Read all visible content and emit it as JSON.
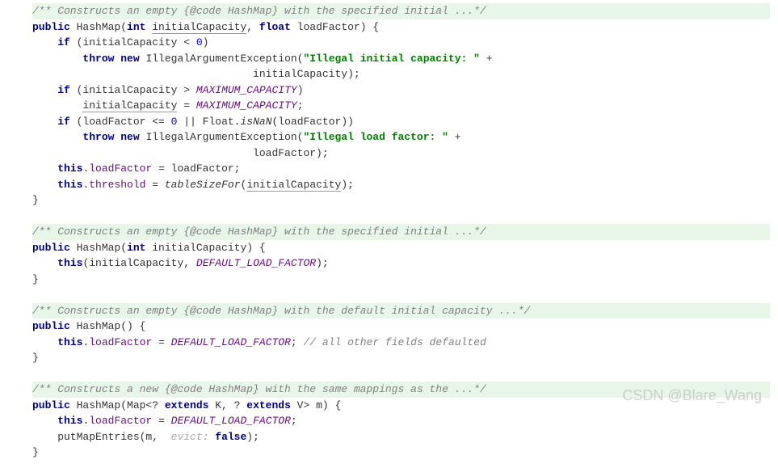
{
  "block1": {
    "doc": "/** Constructs an empty {@code HashMap} with the specified initial ...*/",
    "sig_kw1": "public",
    "sig_name": " HashMap(",
    "sig_kw2": "int",
    "sig_p1": "initialCapacity",
    "sig_sep": ", ",
    "sig_kw3": "float",
    "sig_p2": " loadFactor) {",
    "l1_kw": "if",
    "l1_rest": " (initialCapacity < ",
    "l1_num": "0",
    "l1_end": ")",
    "l2_kw1": "throw new",
    "l2_cls": " IllegalArgumentException(",
    "l2_str": "\"Illegal initial capacity: \"",
    "l2_end": " +",
    "l3": "                                   initialCapacity);",
    "l4_kw": "if",
    "l4_rest": " (initialCapacity > ",
    "l4_const": "MAXIMUM_CAPACITY",
    "l4_end": ")",
    "l5_p": "initialCapacity",
    "l5_mid": " = ",
    "l5_const": "MAXIMUM_CAPACITY",
    "l5_end": ";",
    "l6_kw": "if",
    "l6_a": " (loadFactor <= ",
    "l6_num": "0",
    "l6_b": " || Float.",
    "l6_m": "isNaN",
    "l6_c": "(loadFactor))",
    "l7_kw": "throw new",
    "l7_cls": " IllegalArgumentException(",
    "l7_str": "\"Illegal load factor: \"",
    "l7_end": " +",
    "l8": "                                   loadFactor);",
    "l9_kw": "this",
    "l9_a": ".",
    "l9_f": "loadFactor",
    "l9_b": " = loadFactor;",
    "l10_kw": "this",
    "l10_a": ".",
    "l10_f": "threshold",
    "l10_b": " = ",
    "l10_m": "tableSizeFor",
    "l10_c": "(",
    "l10_p": "initialCapacity",
    "l10_d": ");",
    "close": "}"
  },
  "block2": {
    "doc": "/** Constructs an empty {@code HashMap} with the specified initial ...*/",
    "sig_kw1": "public",
    "sig_name": " HashMap(",
    "sig_kw2": "int",
    "sig_p1": " initialCapacity) {",
    "l1_kw": "this",
    "l1_a": "(initialCapacity, ",
    "l1_const": "DEFAULT_LOAD_FACTOR",
    "l1_b": ");",
    "close": "}"
  },
  "block3": {
    "doc": "/** Constructs an empty {@code HashMap} with the default initial capacity ...*/",
    "sig_kw1": "public",
    "sig_name": " HashMap() {",
    "l1_kw": "this",
    "l1_a": ".",
    "l1_f": "loadFactor",
    "l1_b": " = ",
    "l1_const": "DEFAULT_LOAD_FACTOR",
    "l1_c": "; ",
    "l1_cmt": "// all other fields defaulted",
    "close": "}"
  },
  "block4": {
    "doc": "/** Constructs a new {@code HashMap} with the same mappings as the ...*/",
    "sig_kw1": "public",
    "sig_a": " HashMap(Map<? ",
    "sig_kw2": "extends",
    "sig_b": " K, ? ",
    "sig_kw3": "extends",
    "sig_c": " V> m) {",
    "l1_kw": "this",
    "l1_a": ".",
    "l1_f": "loadFactor",
    "l1_b": " = ",
    "l1_const": "DEFAULT_LOAD_FACTOR",
    "l1_c": ";",
    "l2_a": "putMapEntries(m, ",
    "l2_hint": " evict: ",
    "l2_kw": "false",
    "l2_b": ");",
    "close": "}"
  },
  "watermark": "CSDN @Blare_Wang"
}
